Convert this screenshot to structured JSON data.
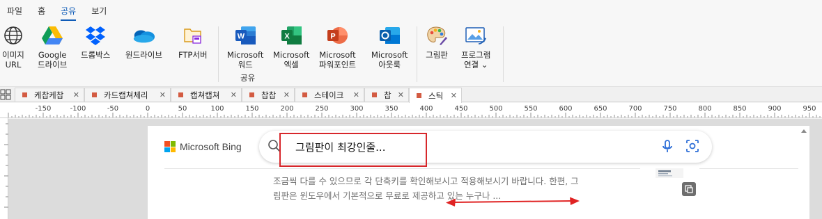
{
  "menu": [
    "파일",
    "홈",
    "공유",
    "보기"
  ],
  "active_menu_index": 2,
  "ribbon": {
    "buttons": [
      {
        "name": "image-url",
        "line1": "이미지",
        "line2": "URL",
        "icon": "globe-icon"
      },
      {
        "name": "google-drive",
        "line1": "Google",
        "line2": "드라이브",
        "icon": "google-drive-icon"
      },
      {
        "name": "dropbox",
        "line1": "드롭박스",
        "line2": "",
        "icon": "dropbox-icon"
      },
      {
        "name": "onedrive",
        "line1": "원드라이브",
        "line2": "",
        "icon": "onedrive-icon"
      },
      {
        "name": "ftp",
        "line1": "FTP서버",
        "line2": "",
        "icon": "ftp-folder-icon"
      },
      {
        "name": "word",
        "line1": "Microsoft",
        "line2": "워드",
        "icon": "word-icon"
      },
      {
        "name": "excel",
        "line1": "Microsoft",
        "line2": "엑셀",
        "icon": "excel-icon"
      },
      {
        "name": "powerpoint",
        "line1": "Microsoft",
        "line2": "파워포인트",
        "icon": "powerpoint-icon"
      },
      {
        "name": "outlook",
        "line1": "Microsoft",
        "line2": "아웃룩",
        "icon": "outlook-icon"
      },
      {
        "name": "paint",
        "line1": "그림판",
        "line2": "",
        "icon": "paint-palette-icon"
      },
      {
        "name": "program-link",
        "line1": "프로그램",
        "line2": "연결 ⌄",
        "icon": "program-link-icon"
      }
    ],
    "group_label": "공유"
  },
  "tabs": [
    {
      "label": "케찹케찹",
      "active": false
    },
    {
      "label": "카드캡쳐체리",
      "active": false
    },
    {
      "label": "캡쳐캡쳐",
      "active": false
    },
    {
      "label": "찹찹",
      "active": false
    },
    {
      "label": "스테이크",
      "active": false
    },
    {
      "label": "찹",
      "active": false
    },
    {
      "label": "스틱",
      "active": true
    }
  ],
  "ruler_ticks": [
    "-150",
    "-100",
    "-50",
    "0",
    "50",
    "100",
    "150",
    "200",
    "250",
    "300",
    "350",
    "400",
    "450",
    "500",
    "550",
    "600",
    "650",
    "700",
    "750",
    "800",
    "850",
    "900",
    "950"
  ],
  "bing": {
    "brand": "Microsoft Bing",
    "query": "그림판이 최강인줄...",
    "snippet_line1": "조금씩 다를 수 있으므로 각 단축키를 확인해보시고 적용해보시기 바랍니다. 한편, 그",
    "snippet_line2": "림판은 윈도우에서 기본적으로 무료로 제공하고 있는 누구나 ..."
  },
  "colors": {
    "accent": "#0f5cb8",
    "highlight_red": "#d7272b",
    "tab_dot": "#d35b42"
  }
}
